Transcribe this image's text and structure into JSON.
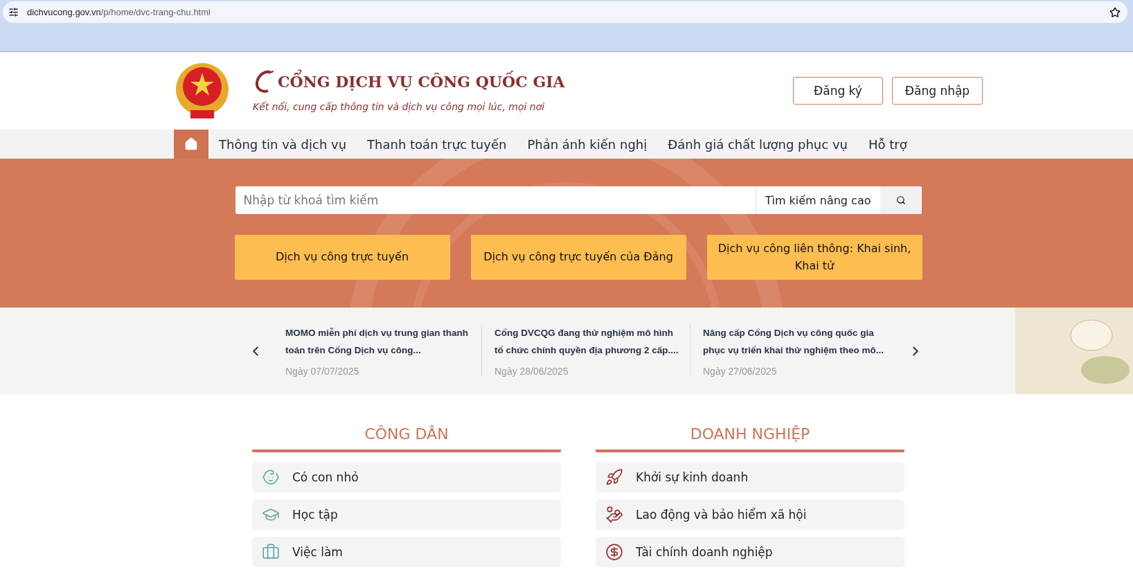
{
  "browser": {
    "url_host": "dichvucong.gov.vn",
    "url_path": "/p/home/dvc-trang-chu.html"
  },
  "header": {
    "title": "CỔNG DỊCH VỤ CÔNG QUỐC GIA",
    "slogan": "Kết nối, cung cấp thông tin và dịch vụ công mọi lúc, mọi nơi",
    "buttons": [
      "Đăng ký",
      "Đăng nhập"
    ]
  },
  "nav": {
    "home_selected": true,
    "items": [
      {
        "label": "Thông tin và dịch vụ",
        "selected": false
      },
      {
        "label": "Thanh toán trực tuyến",
        "selected": false
      },
      {
        "label": "Phản ánh kiến nghị",
        "selected": false
      },
      {
        "label": "Đánh giá chất lượng phục vụ",
        "selected": false
      },
      {
        "label": "Hỗ trợ",
        "selected": false
      }
    ]
  },
  "search": {
    "placeholder": "Nhập từ khoá tìm kiếm",
    "advanced": "Tìm kiếm nâng cao"
  },
  "quick_links": [
    "Dịch vụ công trực tuyến",
    "Dịch vụ công trực tuyến của Đảng",
    "Dịch vụ công liên thông: Khai sinh, Khai tử"
  ],
  "news": [
    {
      "title": "MOMO miễn phí dịch vụ trung gian thanh toán trên Cổng Dịch vụ công...",
      "date": "Ngày 07/07/2025"
    },
    {
      "title": "Cổng DVCQG đang thử nghiệm mô hình tổ chức chính quyền địa phương 2 cấp....",
      "date": "Ngày 28/06/2025"
    },
    {
      "title": "Nâng cấp Cổng Dịch vụ công quốc gia phục vụ triển khai thử nghiệm theo mô...",
      "date": "Ngày 27/06/2025"
    }
  ],
  "sections": [
    {
      "title": "CÔNG DÂN",
      "items": [
        {
          "label": "Có con nhỏ",
          "kind": "baby"
        },
        {
          "label": "Học tập",
          "kind": "study"
        },
        {
          "label": "Việc làm",
          "kind": "job"
        }
      ]
    },
    {
      "title": "DOANH NGHIỆP",
      "items": [
        {
          "label": "Khởi sự kinh doanh",
          "kind": "rocket"
        },
        {
          "label": "Lao động và bảo hiểm xã hội",
          "kind": "labor"
        },
        {
          "label": "Tài chính doanh nghiệp",
          "kind": "finance"
        }
      ]
    }
  ]
}
